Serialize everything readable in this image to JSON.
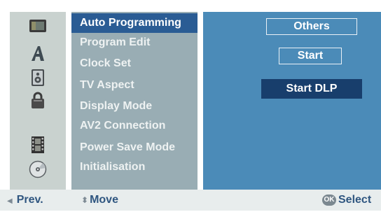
{
  "menu": {
    "items": [
      {
        "label": "Auto Programming",
        "icon": "tv-monitor-icon",
        "selected": true
      },
      {
        "label": "Program Edit",
        "icon": "letter-a-icon",
        "selected": false
      },
      {
        "label": "Clock Set",
        "icon": "speaker-icon",
        "selected": false
      },
      {
        "label": "TV Aspect",
        "icon": "lock-icon",
        "selected": false
      },
      {
        "label": "Display Mode",
        "icon": "film-icon",
        "selected": false
      },
      {
        "label": "AV2 Connection",
        "icon": "disc-icon",
        "selected": false
      },
      {
        "label": "Power Save Mode",
        "selected": false
      },
      {
        "label": "Initialisation",
        "selected": false
      }
    ]
  },
  "options": {
    "others_label": "Others",
    "start_label": "Start",
    "start_dlp_label": "Start DLP"
  },
  "footer": {
    "prev_label": "Prev.",
    "move_label": "Move",
    "ok_badge": "OK",
    "select_label": "Select"
  },
  "colors": {
    "icon_column": "#c9d2cf",
    "menu_column": "#99adb4",
    "menu_highlight": "#2a5c94",
    "options_panel": "#4b8bb8",
    "start_dlp_fill": "#183e6c",
    "footer_text": "#2f5680"
  }
}
